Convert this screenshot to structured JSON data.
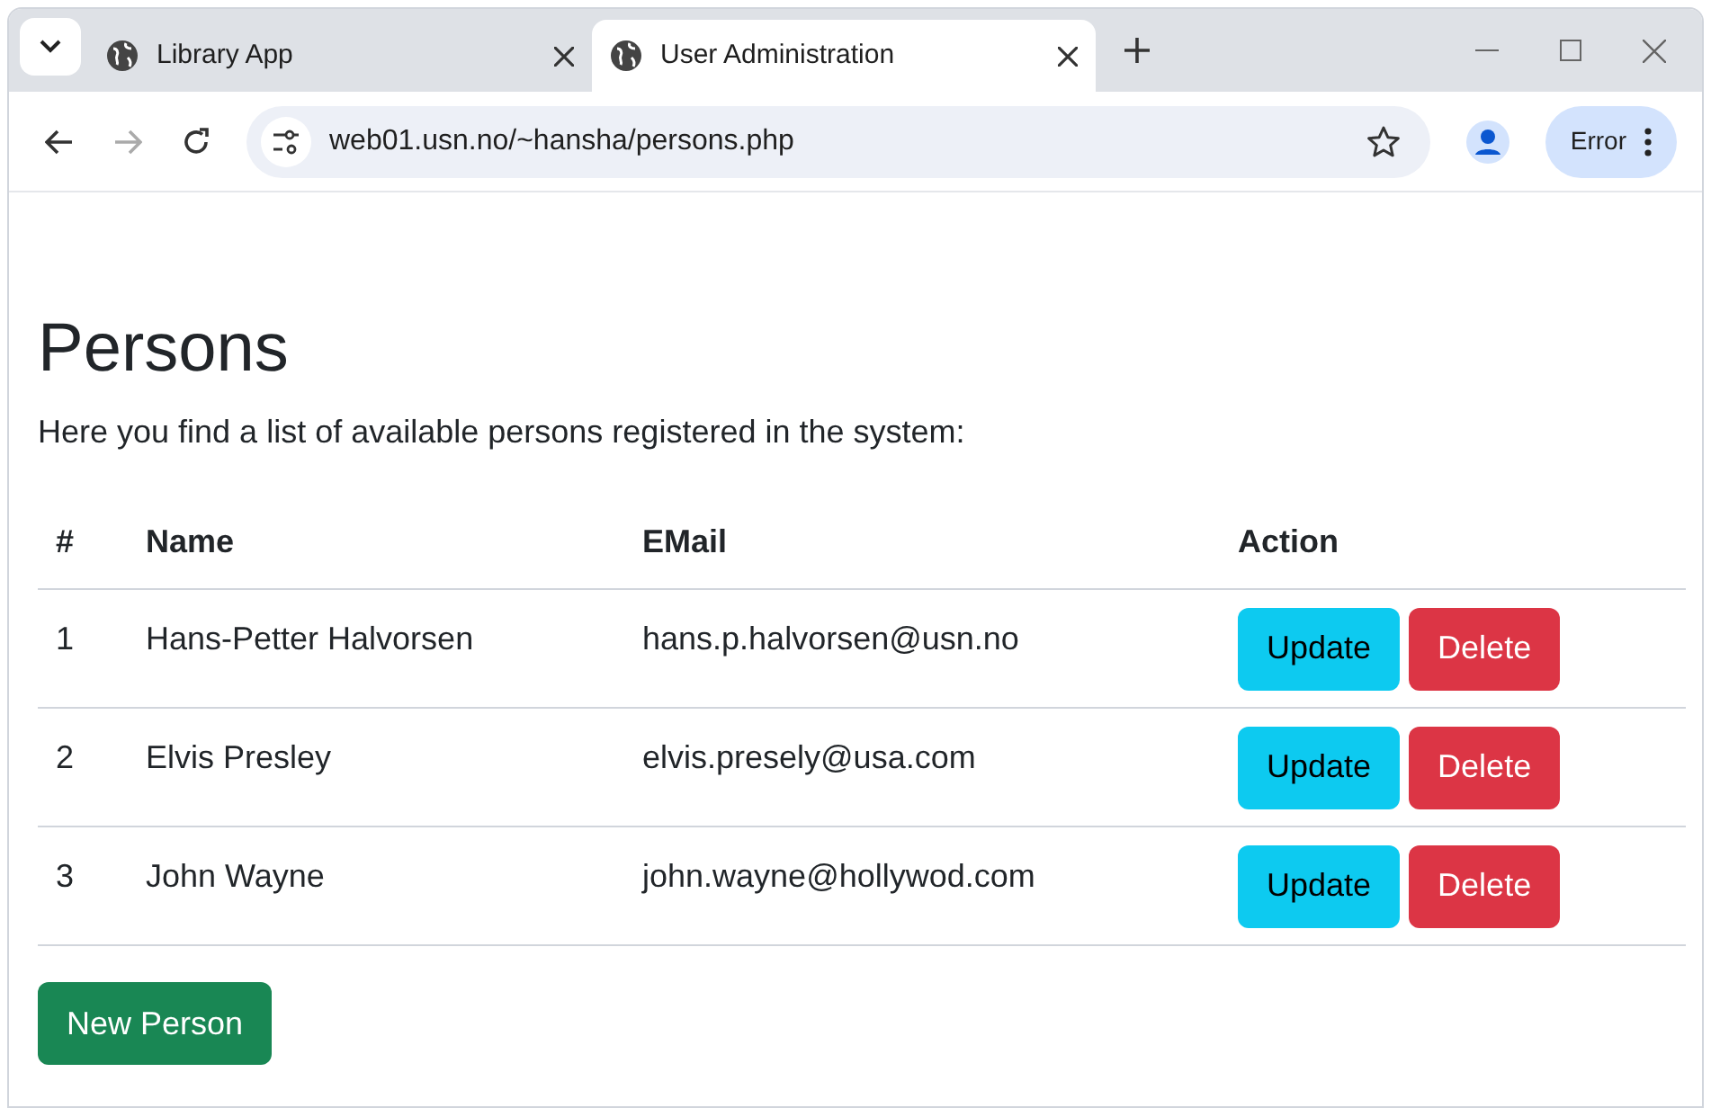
{
  "browser": {
    "tabs": [
      {
        "title": "Library App",
        "selected": false
      },
      {
        "title": "User Administration",
        "selected": true
      }
    ],
    "address": "web01.usn.no/~hansha/persons.php",
    "profile_button": "Error"
  },
  "page": {
    "heading": "Persons",
    "intro": "Here you find a list of available persons registered in the system:",
    "table": {
      "columns": [
        "#",
        "Name",
        "EMail",
        "Action"
      ],
      "rows": [
        {
          "number": "1",
          "name": "Hans-Petter Halvorsen",
          "email": "hans.p.halvorsen@usn.no",
          "actions": [
            "Update",
            "Delete"
          ]
        },
        {
          "number": "2",
          "name": "Elvis Presley",
          "email": "elvis.presely@usa.com",
          "actions": [
            "Update",
            "Delete"
          ]
        },
        {
          "number": "3",
          "name": "John Wayne",
          "email": "john.wayne@hollywod.com",
          "actions": [
            "Update",
            "Delete"
          ]
        }
      ]
    },
    "new_button": "New Person"
  }
}
